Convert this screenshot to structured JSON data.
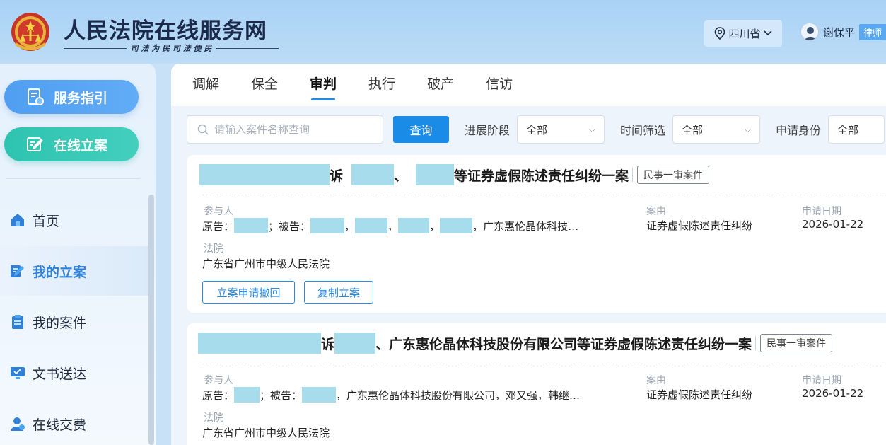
{
  "header": {
    "site_title": "人民法院在线服务网",
    "slogan": "司 法 为 民   司 法 便 民",
    "region": "四川省",
    "user_name": "谢保平",
    "user_role": "律师"
  },
  "sidebar": {
    "guide_button": "服务指引",
    "filing_button": "在线立案",
    "nav": [
      {
        "label": "首页",
        "icon": "home-icon"
      },
      {
        "label": "我的立案",
        "icon": "edit-icon",
        "active": true
      },
      {
        "label": "我的案件",
        "icon": "clipboard-icon"
      },
      {
        "label": "文书送达",
        "icon": "monitor-icon"
      },
      {
        "label": "在线交费",
        "icon": "user-pay-icon"
      }
    ]
  },
  "tabs": [
    "调解",
    "保全",
    "审判",
    "执行",
    "破产",
    "信访"
  ],
  "active_tab": "审判",
  "filters": {
    "search_placeholder": "请输入案件名称查询",
    "query_button": "查询",
    "stage_label": "进展阶段",
    "stage_value": "全部",
    "time_label": "时间筛选",
    "time_value": "全部",
    "identity_label": "申请身份",
    "identity_value": "全部"
  },
  "cases": [
    {
      "title_part1": "诉",
      "title_part2": "、",
      "title_part3": "等证券虚假陈述责任纠纷一案",
      "case_type": "民事一审案件",
      "participants_label": "参与人",
      "participants_prefix": "原告：",
      "participants_mid": "；被告：",
      "participants_tail": "，广东惠伦晶体科技…",
      "cause_label": "案由",
      "cause_value": "证券虚假陈述责任纠纷",
      "date_label": "申请日期",
      "date_value": "2026-01-22",
      "court_label": "法院",
      "court_value": "广东省广州市中级人民法院",
      "withdraw_button": "立案申请撤回",
      "copy_button": "复制立案"
    },
    {
      "title_part1": "诉",
      "title_part2": "、广东惠伦晶体科技股份有限公司等证券虚假陈述责任纠纷一案",
      "case_type": "民事一审案件",
      "participants_label": "参与人",
      "participants_prefix": "原告：",
      "participants_mid": "；被告：",
      "participants_tail": "，广东惠伦晶体科技股份有限公司，邓又强，韩继…",
      "cause_label": "案由",
      "cause_value": "证券虚假陈述责任纠纷",
      "date_label": "申请日期",
      "date_value": "2026-01-22",
      "court_label": "法院",
      "court_value": "广东省广州市中级人民法院"
    }
  ],
  "colors": {
    "primary": "#1b8be8",
    "teal": "#2ec3b0",
    "redaction": "#a6dcec"
  }
}
